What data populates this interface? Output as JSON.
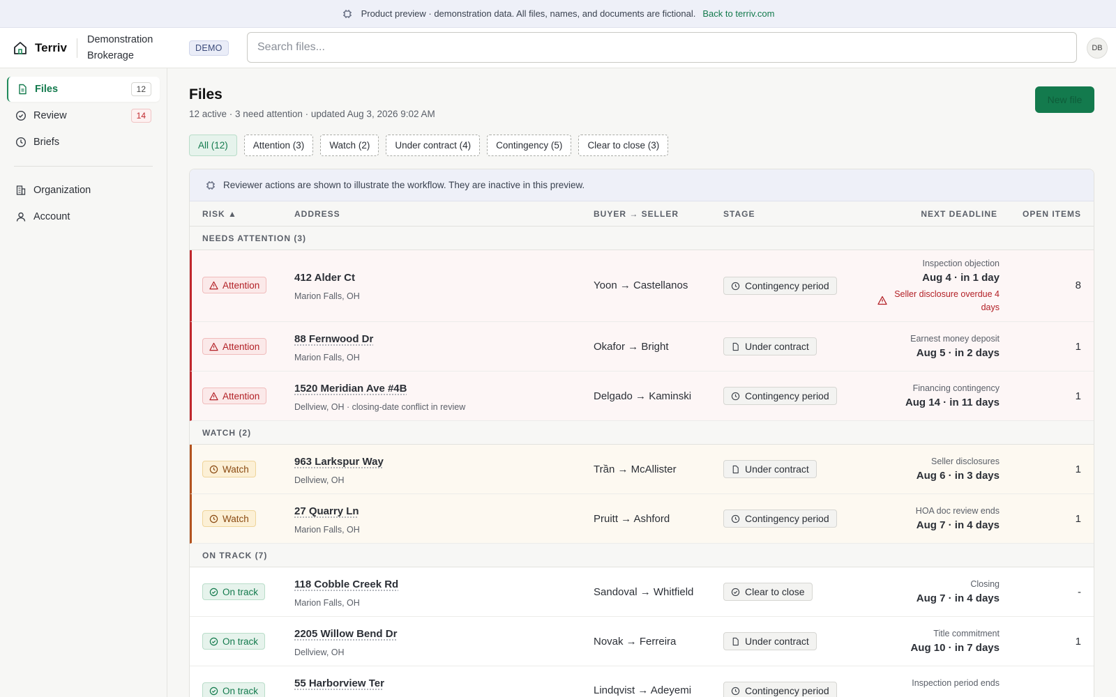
{
  "banner": {
    "text": "Product preview · demonstration data. All files, names, and documents are fictional.",
    "link": "Back to terriv.com"
  },
  "topbar": {
    "brand": "Terriv",
    "org": "Demonstration Brokerage",
    "badge": "DEMO",
    "search_placeholder": "Search files...",
    "avatar": "DB"
  },
  "sidebar": {
    "items": [
      {
        "label": "Files",
        "count": "12"
      },
      {
        "label": "Review",
        "count": "14"
      },
      {
        "label": "Briefs"
      },
      {
        "label": "Organization"
      },
      {
        "label": "Account"
      }
    ]
  },
  "main": {
    "title": "Files",
    "subtitle": "12 active · 3 need attention · updated Aug 3, 2026 9:02 AM",
    "new_button": "New file",
    "filters": [
      "All (12)",
      "Attention (3)",
      "Watch (2)",
      "Under contract (4)",
      "Contingency (5)",
      "Clear to close (3)"
    ],
    "notice": "Reviewer actions are shown to illustrate the workflow. They are inactive in this preview.",
    "columns": [
      "RISK ▲",
      "ADDRESS",
      "BUYER → SELLER",
      "STAGE",
      "NEXT DEADLINE",
      "OPEN ITEMS"
    ],
    "groups": [
      "NEEDS ATTENTION (3)",
      "WATCH (2)",
      "ON TRACK (7)"
    ],
    "rows": [
      {
        "risk": "Attention",
        "address": "412 Alder Ct",
        "location": "Marion Falls, OH",
        "parties": "Yoon → Castellanos",
        "stage": "Contingency period",
        "deadline_label": "Inspection objection",
        "deadline_date": "Aug 4 · in 1 day",
        "warning": "Seller disclosure overdue 4 days",
        "open": "8"
      },
      {
        "risk": "Attention",
        "address": "88 Fernwood Dr",
        "location": "Marion Falls, OH",
        "parties": "Okafor → Bright",
        "stage": "Under contract",
        "deadline_label": "Earnest money deposit",
        "deadline_date": "Aug 5 · in 2 days",
        "open": "1"
      },
      {
        "risk": "Attention",
        "address": "1520 Meridian Ave #4B",
        "location": "Dellview, OH · closing-date conflict in review",
        "parties": "Delgado → Kaminski",
        "stage": "Contingency period",
        "deadline_label": "Financing contingency",
        "deadline_date": "Aug 14 · in 11 days",
        "open": "1"
      },
      {
        "risk": "Watch",
        "address": "963 Larkspur Way",
        "location": "Dellview, OH",
        "parties": "Trần → McAllister",
        "stage": "Under contract",
        "deadline_label": "Seller disclosures",
        "deadline_date": "Aug 6 · in 3 days",
        "open": "1"
      },
      {
        "risk": "Watch",
        "address": "27 Quarry Ln",
        "location": "Marion Falls, OH",
        "parties": "Pruitt → Ashford",
        "stage": "Contingency period",
        "deadline_label": "HOA doc review ends",
        "deadline_date": "Aug 7 · in 4 days",
        "open": "1"
      },
      {
        "risk": "On track",
        "address": "118 Cobble Creek Rd",
        "location": "Marion Falls, OH",
        "parties": "Sandoval → Whitfield",
        "stage": "Clear to close",
        "deadline_label": "Closing",
        "deadline_date": "Aug 7 · in 4 days",
        "open": "-"
      },
      {
        "risk": "On track",
        "address": "2205 Willow Bend Dr",
        "location": "Dellview, OH",
        "parties": "Novak → Ferreira",
        "stage": "Under contract",
        "deadline_label": "Title commitment",
        "deadline_date": "Aug 10 · in 7 days",
        "open": "1"
      },
      {
        "risk": "On track",
        "address": "55 Harborview Ter",
        "location": "",
        "parties": "Lindqvist → Adeyemi",
        "stage": "Contingency period",
        "deadline_label": "Inspection period ends",
        "deadline_date": "",
        "open": ""
      }
    ]
  },
  "colors": {
    "accent": "#137a4d",
    "attention": "#c0272d",
    "watch": "#b3531f",
    "notice_bg": "#eef0f8"
  }
}
